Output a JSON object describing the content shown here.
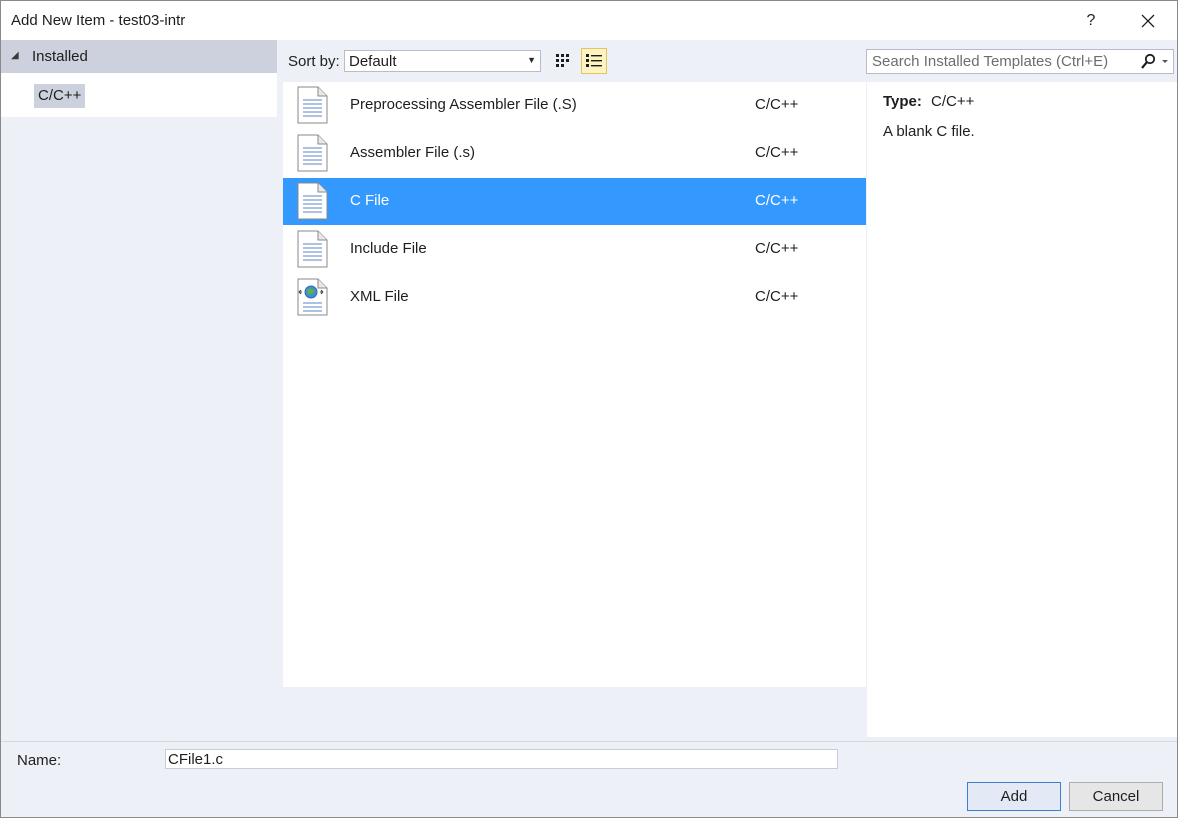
{
  "window": {
    "title": "Add New Item - test03-intr",
    "help_label": "?",
    "close_label": "✕"
  },
  "tree": {
    "header": "Installed",
    "items": [
      {
        "label": "C/C++",
        "selected": true
      }
    ]
  },
  "toolbar": {
    "sort_label": "Sort by:",
    "sort_value": "Default",
    "search_placeholder": "Search Installed Templates (Ctrl+E)"
  },
  "templates": [
    {
      "name": "Preprocessing Assembler File (.S)",
      "lang": "C/C++",
      "icon": "document-icon",
      "selected": false
    },
    {
      "name": "Assembler File (.s)",
      "lang": "C/C++",
      "icon": "document-icon",
      "selected": false
    },
    {
      "name": "C File",
      "lang": "C/C++",
      "icon": "document-icon",
      "selected": true
    },
    {
      "name": "Include File",
      "lang": "C/C++",
      "icon": "document-icon",
      "selected": false
    },
    {
      "name": "XML File",
      "lang": "C/C++",
      "icon": "xml-file-icon",
      "selected": false
    }
  ],
  "details": {
    "type_label": "Type:",
    "type_value": "C/C++",
    "description": "A blank C file."
  },
  "footer": {
    "name_label": "Name:",
    "name_value": "CFile1.c",
    "add_label": "Add",
    "cancel_label": "Cancel"
  },
  "colors": {
    "selection": "#3399ff",
    "panel_bg": "#eef0f8",
    "tree_header_bg": "#cdd1dd",
    "view_active_bg": "#fdf4bf"
  }
}
